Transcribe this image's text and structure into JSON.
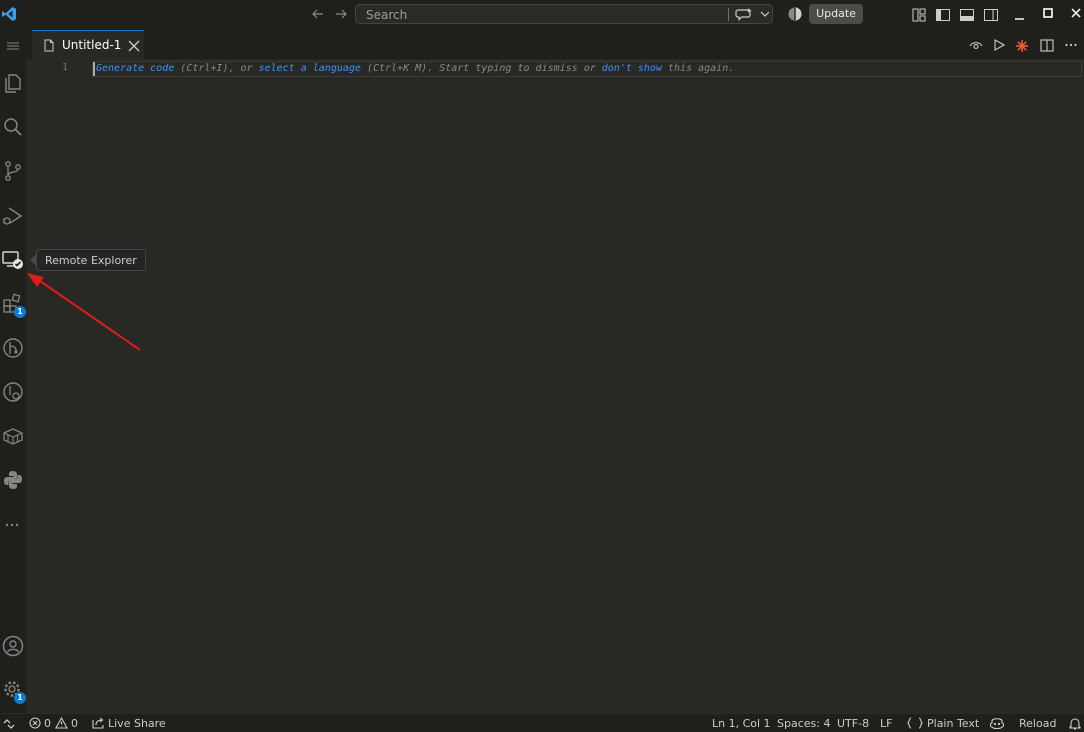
{
  "titlebar": {
    "search_placeholder": "Search",
    "update_label": "Update"
  },
  "tabs": [
    {
      "label": "Untitled-1"
    }
  ],
  "editor": {
    "line_number": "1",
    "hint": {
      "part1": "Generate code",
      "part2": " (Ctrl+I), or ",
      "part3": "select a language",
      "part4": " (Ctrl+K M). Start typing to dismiss or ",
      "part5": "don't show",
      "part6": " this again."
    }
  },
  "activitybar": {
    "extensions_badge": "1",
    "settings_badge": "1",
    "tooltip": "Remote Explorer"
  },
  "statusbar": {
    "errors": "0",
    "warnings": "0",
    "live_share": "Live Share",
    "position": "Ln 1, Col 1",
    "spaces": "Spaces: 4",
    "encoding": "UTF-8",
    "eol": "LF",
    "language": "Plain Text",
    "reload": "Reload"
  },
  "colors": {
    "accent": "#0c7bd3",
    "annotation": "#e01b1b",
    "editor_bg": "#282824",
    "chrome_bg": "#1f1f1c"
  }
}
